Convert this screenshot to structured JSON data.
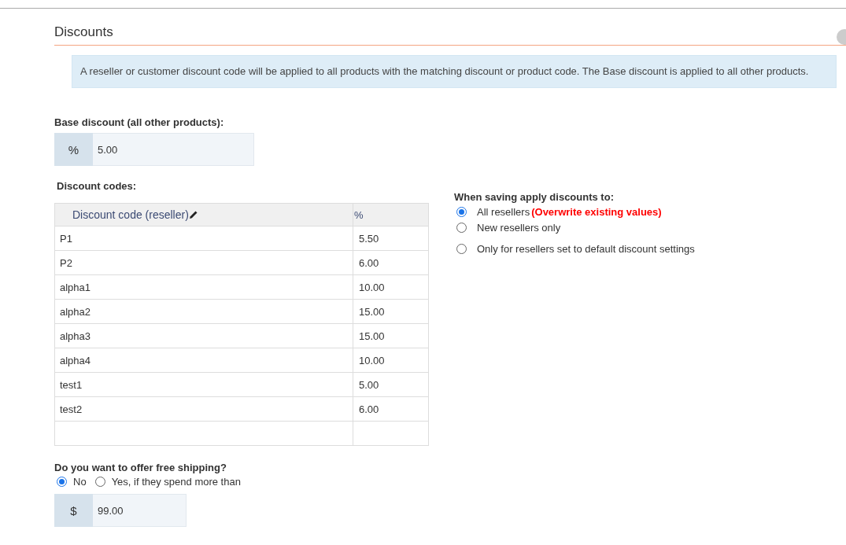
{
  "section": {
    "title": "Discounts"
  },
  "info": "A reseller or customer discount code will be applied to all products with the matching discount or product code. The Base discount is applied to all other products.",
  "base_discount": {
    "label": "Base discount (all other products):",
    "addon": "%",
    "value": "5.00"
  },
  "discount_codes": {
    "label": "Discount codes:",
    "columns": [
      "Discount code (reseller)",
      "%"
    ],
    "rows": [
      {
        "code": "P1",
        "percent": "5.50"
      },
      {
        "code": "P2",
        "percent": "6.00"
      },
      {
        "code": "alpha1",
        "percent": "10.00"
      },
      {
        "code": "alpha2",
        "percent": "15.00"
      },
      {
        "code": "alpha3",
        "percent": "15.00"
      },
      {
        "code": "alpha4",
        "percent": "10.00"
      },
      {
        "code": "test1",
        "percent": "5.00"
      },
      {
        "code": "test2",
        "percent": "6.00"
      }
    ]
  },
  "apply_to": {
    "label": "When saving apply discounts to:",
    "options": [
      {
        "label": "All resellers",
        "note": "(Overwrite existing values)",
        "selected": true
      },
      {
        "label": "New resellers only",
        "selected": false
      },
      {
        "label": "Only for resellers set to default discount settings",
        "selected": false
      }
    ]
  },
  "free_shipping": {
    "label": "Do you want to offer free shipping?",
    "options": [
      {
        "label": "No",
        "selected": true
      },
      {
        "label": "Yes, if they spend more than",
        "selected": false
      }
    ],
    "addon": "$",
    "value": "99.00"
  }
}
